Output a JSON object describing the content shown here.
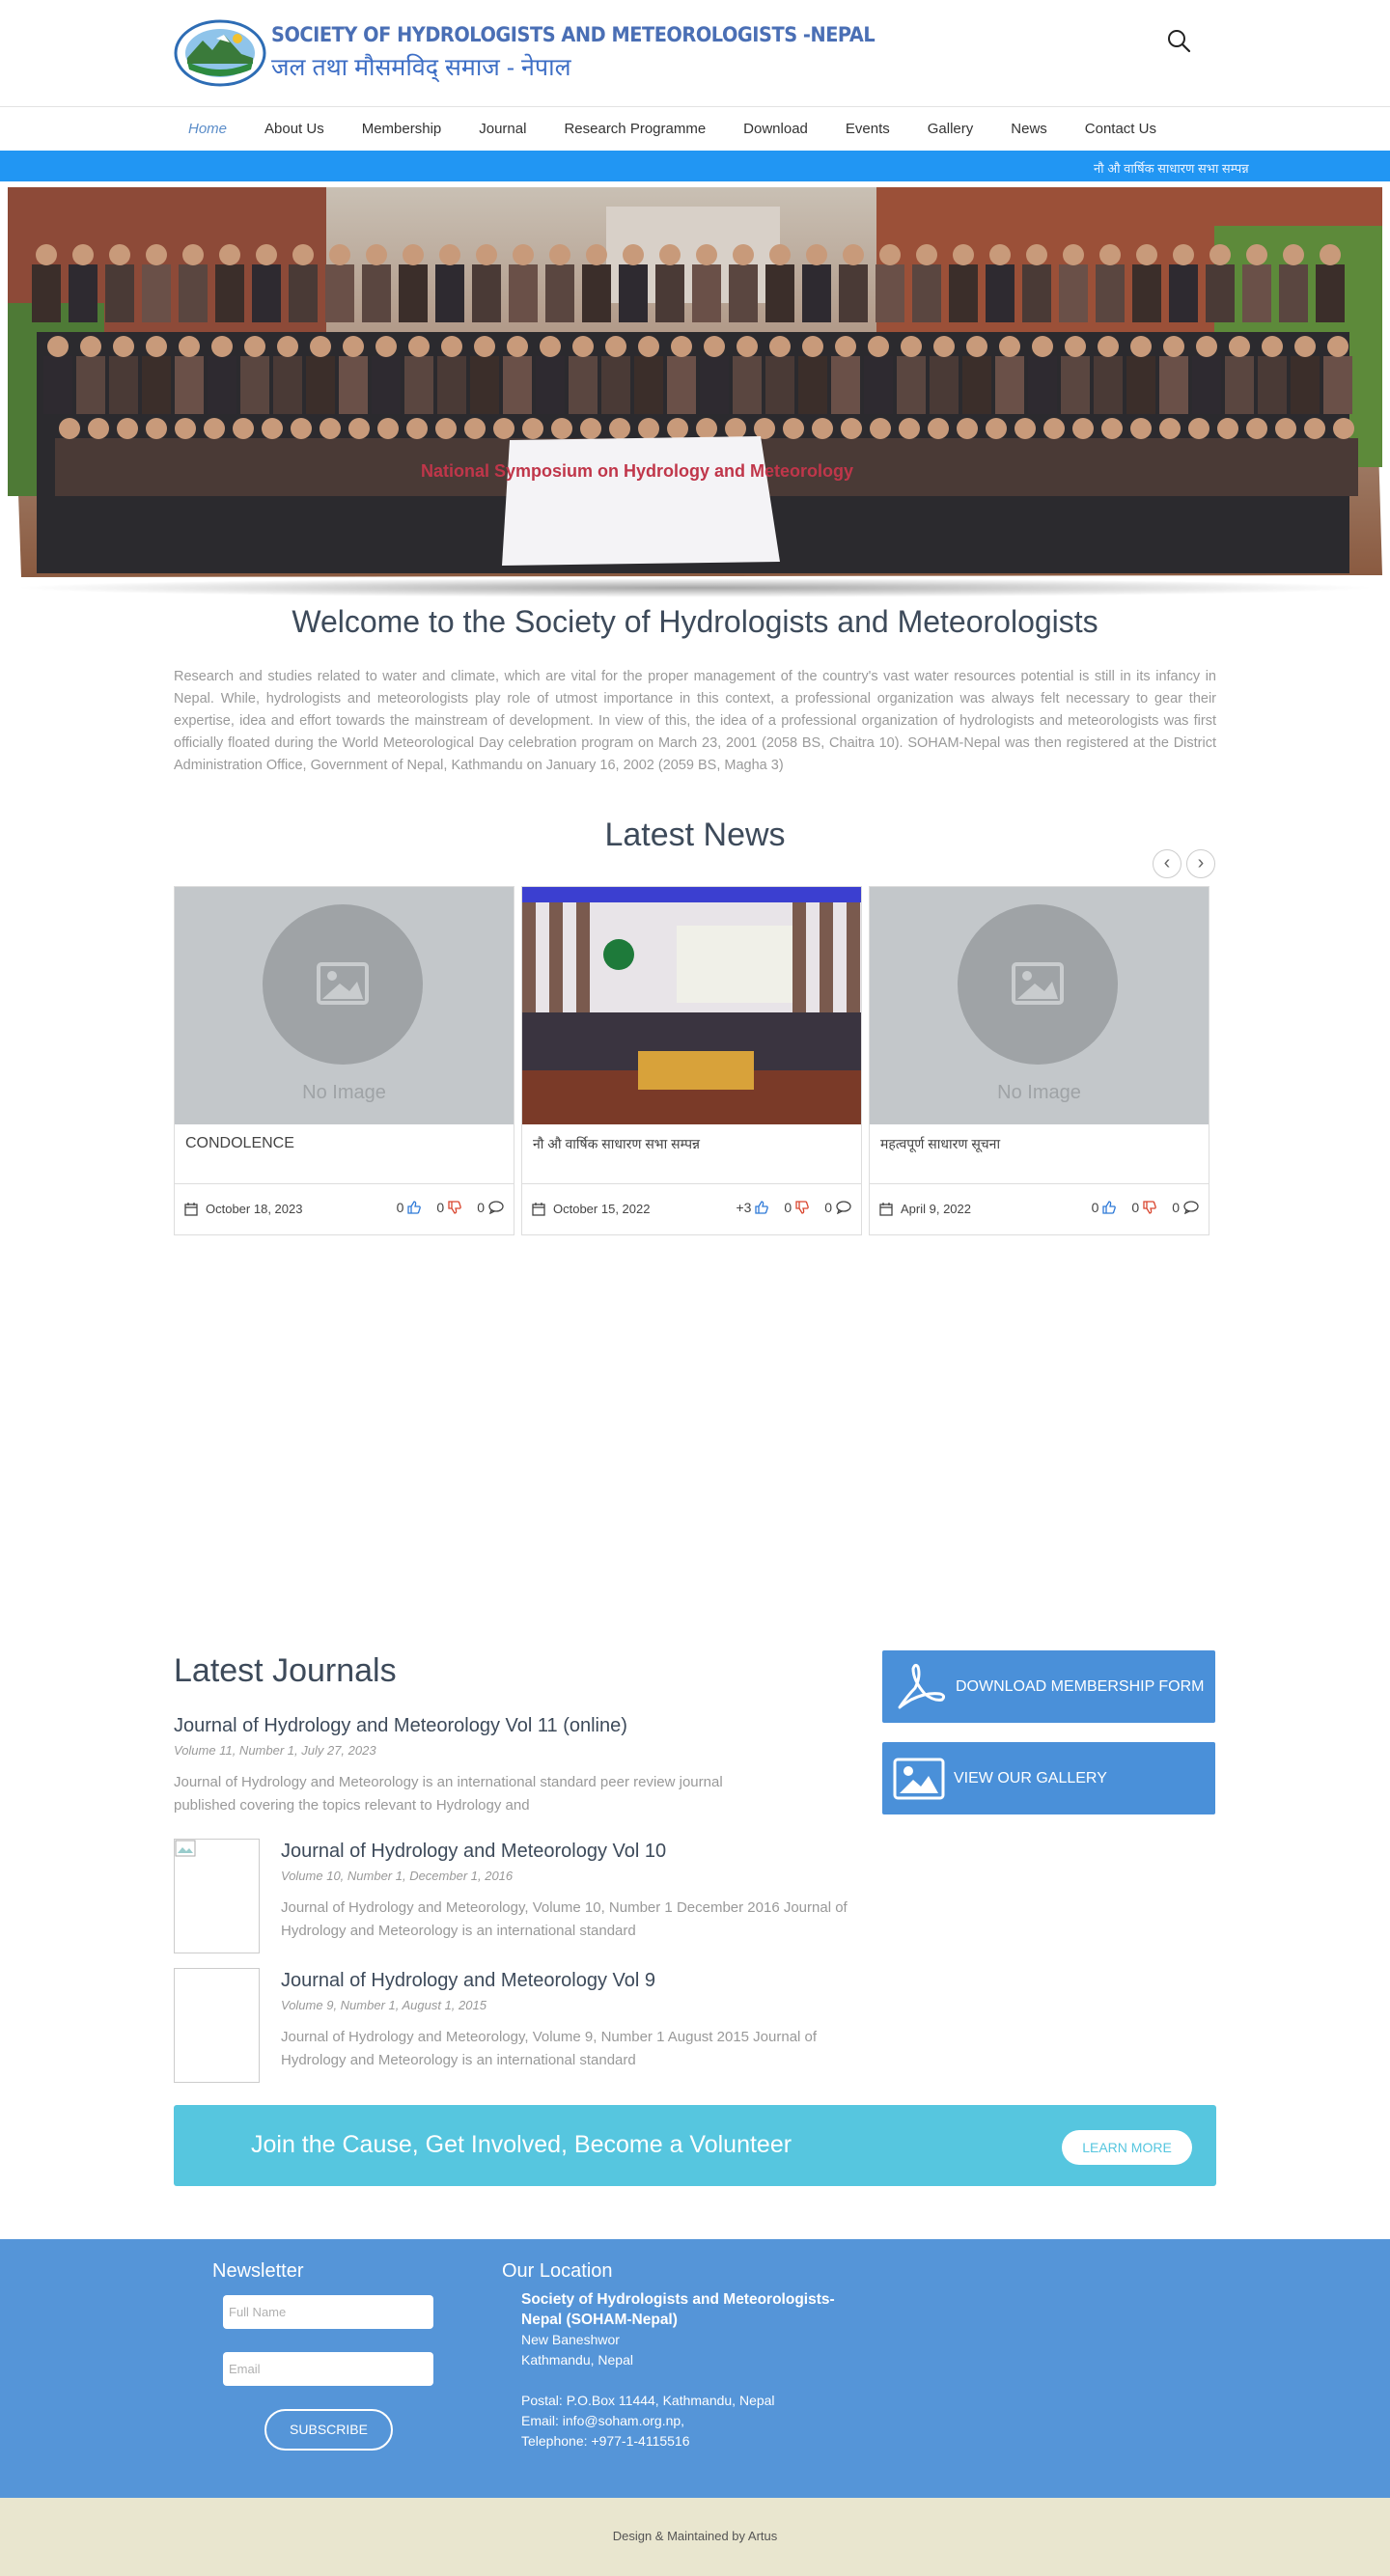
{
  "header": {
    "brand_en": "SOCIETY OF HYDROLOGISTS AND METEOROLOGISTS -NEPAL",
    "brand_np": "जल तथा मौसमविद् समाज - नेपाल",
    "logo_icon": "logo-globe-icon",
    "search_icon": "search-icon"
  },
  "nav": {
    "items": [
      "Home",
      "About Us",
      "Membership",
      "Journal",
      "Research Programme",
      "Download",
      "Events",
      "Gallery",
      "News",
      "Contact Us"
    ],
    "active": "Home"
  },
  "ticker": {
    "text": "नौ औ वार्षिक साधारण सभा सम्पन्न"
  },
  "hero": {
    "banner_text": "National Symposium on Hydrology and Meteorology"
  },
  "welcome": {
    "title": "Welcome to the Society of Hydrologists and Meteorologists",
    "text": "Research and studies related to water and climate, which are vital for the proper management of the country's vast water resources potential is still in its infancy in Nepal. While, hydrologists and meteorologists play role of utmost importance in this context, a professional organization was always felt necessary to gear their expertise, idea and effort towards the mainstream of development. In view of this, the idea of a professional organization of hydrologists and meteorologists was first officially floated during the World Meteorological Day celebration program on March 23, 2001 (2058 BS, Chaitra 10). SOHAM-Nepal was then registered at the District Administration Office, Government of Nepal, Kathmandu on January 16, 2002 (2059 BS, Magha 3)"
  },
  "news": {
    "title": "Latest News",
    "prev": "‹",
    "next": "›",
    "no_image": "No Image",
    "cards": [
      {
        "title": "CONDOLENCE",
        "date": "October 18, 2023",
        "likes": "0",
        "dislikes": "0",
        "comments": "0",
        "has_image": false
      },
      {
        "title": "नौ औ वार्षिक साधारण सभा सम्पन्न",
        "date": "October 15, 2022",
        "likes": "+3",
        "dislikes": "0",
        "comments": "0",
        "has_image": true
      },
      {
        "title": "महत्वपूर्ण साधारण सूचना",
        "date": "April 9, 2022",
        "likes": "0",
        "dislikes": "0",
        "comments": "0",
        "has_image": false
      }
    ]
  },
  "journals": {
    "title": "Latest Journals",
    "main": {
      "title": "Journal of Hydrology and Meteorology Vol 11 (online)",
      "sub": "Volume 11, Number 1, July 27, 2023",
      "desc": "Journal of Hydrology and Meteorology is an international standard peer review journal published covering the topics relevant to Hydrology and"
    },
    "items": [
      {
        "title": "Journal of Hydrology and Meteorology Vol 10",
        "sub": "Volume 10, Number 1, December 1, 2016",
        "desc": "Journal of Hydrology and Meteorology, Volume 10, Number 1 December 2016 Journal of Hydrology and Meteorology is an international standard"
      },
      {
        "title": "Journal of Hydrology and Meteorology Vol 9",
        "sub": "Volume 9, Number 1, August 1, 2015",
        "desc": "Journal of Hydrology and Meteorology, Volume 9, Number 1 August 2015 Journal of Hydrology and Meteorology is an international standard"
      }
    ]
  },
  "sidebar": {
    "download_label": "DOWNLOAD MEMBERSHIP FORM",
    "gallery_label": "VIEW OUR GALLERY"
  },
  "volunteer": {
    "text": "Join the Cause, Get Involved, Become a Volunteer",
    "button": "LEARN MORE"
  },
  "footer": {
    "newsletter_title": "Newsletter",
    "name_placeholder": "Full Name",
    "email_placeholder": "Email",
    "subscribe": "SUBSCRIBE",
    "location_title": "Our Location",
    "org_name": "Society of Hydrologists and Meteorologists-Nepal (SOHAM-Nepal)",
    "address1": "New Baneshwor",
    "address2": "Kathmandu, Nepal",
    "postal": "Postal: P.O.Box 11444, Kathmandu, Nepal",
    "email": "Email: info@soham.org.np,",
    "phone": "Telephone: +977-1-4115516"
  },
  "bottom": {
    "credit": "Design & Maintained by Artus"
  },
  "colors": {
    "brand": "#4a6fb5",
    "ticker": "#2196f3",
    "footer": "#5595d8",
    "volunteer": "#56c6df",
    "side_button": "#4a90d9",
    "like": "#2f7ad8",
    "dislike": "#d9452e"
  }
}
